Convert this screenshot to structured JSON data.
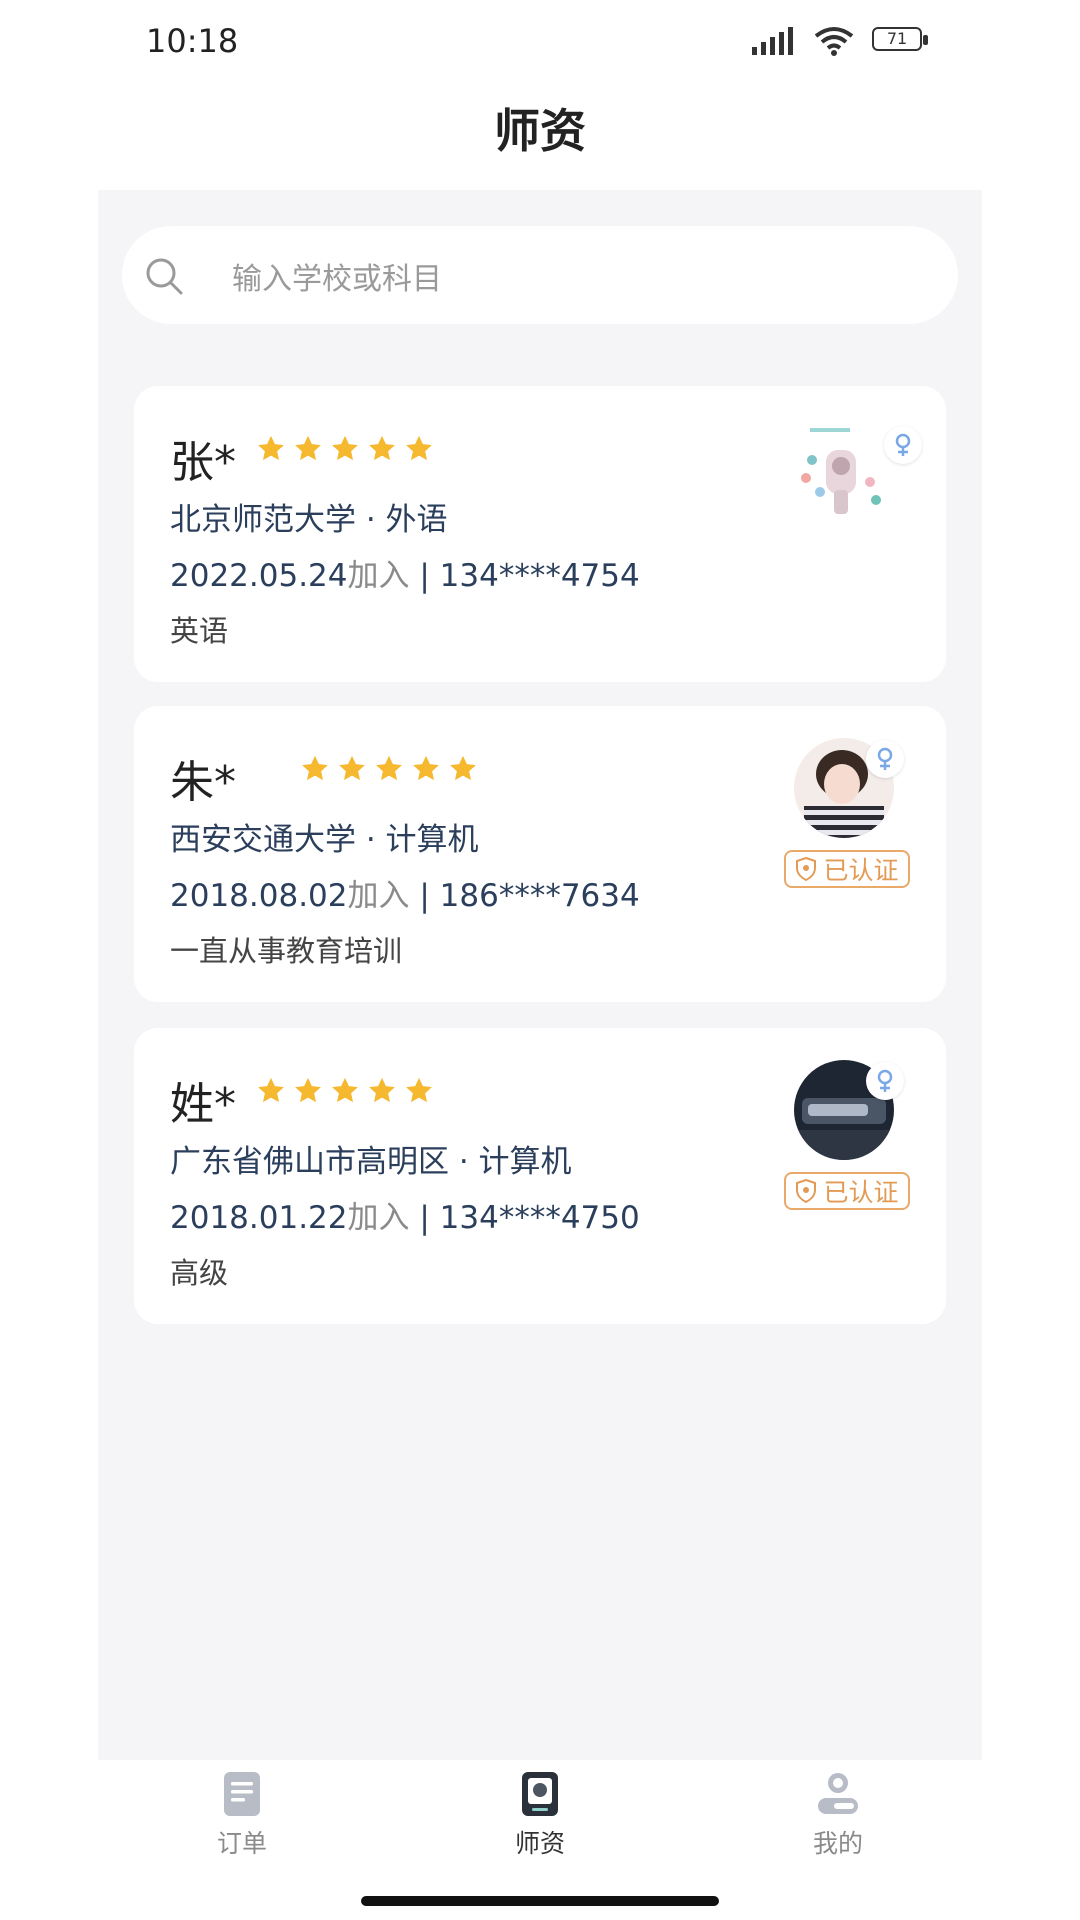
{
  "status_bar": {
    "time": "10:18",
    "battery": "71",
    "icons": [
      "signal-icon",
      "wifi-icon",
      "battery-icon"
    ]
  },
  "header": {
    "title": "师资"
  },
  "search": {
    "placeholder": "输入学校或科目",
    "icon": "search-icon"
  },
  "teachers": [
    {
      "name": "张*",
      "rating": 5,
      "school": "北京师范大学 · 外语",
      "join_date": "2022.05.24",
      "join_label": "加入",
      "separator": " | ",
      "phone": "134****4754",
      "note": "英语",
      "gender": "female",
      "verified": false,
      "verified_label": ""
    },
    {
      "name": "朱*",
      "rating": 5,
      "school": "西安交通大学 · 计算机",
      "join_date": "2018.08.02",
      "join_label": "加入",
      "separator": " | ",
      "phone": "186****7634",
      "note": "一直从事教育培训",
      "gender": "female",
      "verified": true,
      "verified_label": "已认证"
    },
    {
      "name": "姓*",
      "rating": 5,
      "school": "广东省佛山市高明区 · 计算机",
      "join_date": "2018.01.22",
      "join_label": "加入",
      "separator": " | ",
      "phone": "134****4750",
      "note": "高级",
      "gender": "female",
      "verified": true,
      "verified_label": "已认证"
    }
  ],
  "tab_bar": {
    "items": [
      {
        "label": "订单",
        "icon": "order-icon",
        "active": false
      },
      {
        "label": "师资",
        "icon": "teacher-icon",
        "active": true
      },
      {
        "label": "我的",
        "icon": "profile-icon",
        "active": false
      }
    ]
  },
  "colors": {
    "star": "#f5b82e",
    "accent_badge": "#e39a55",
    "gender": "#7aa8e6",
    "text_blue": "#2b3f5c",
    "content_bg": "#f5f5f7"
  }
}
